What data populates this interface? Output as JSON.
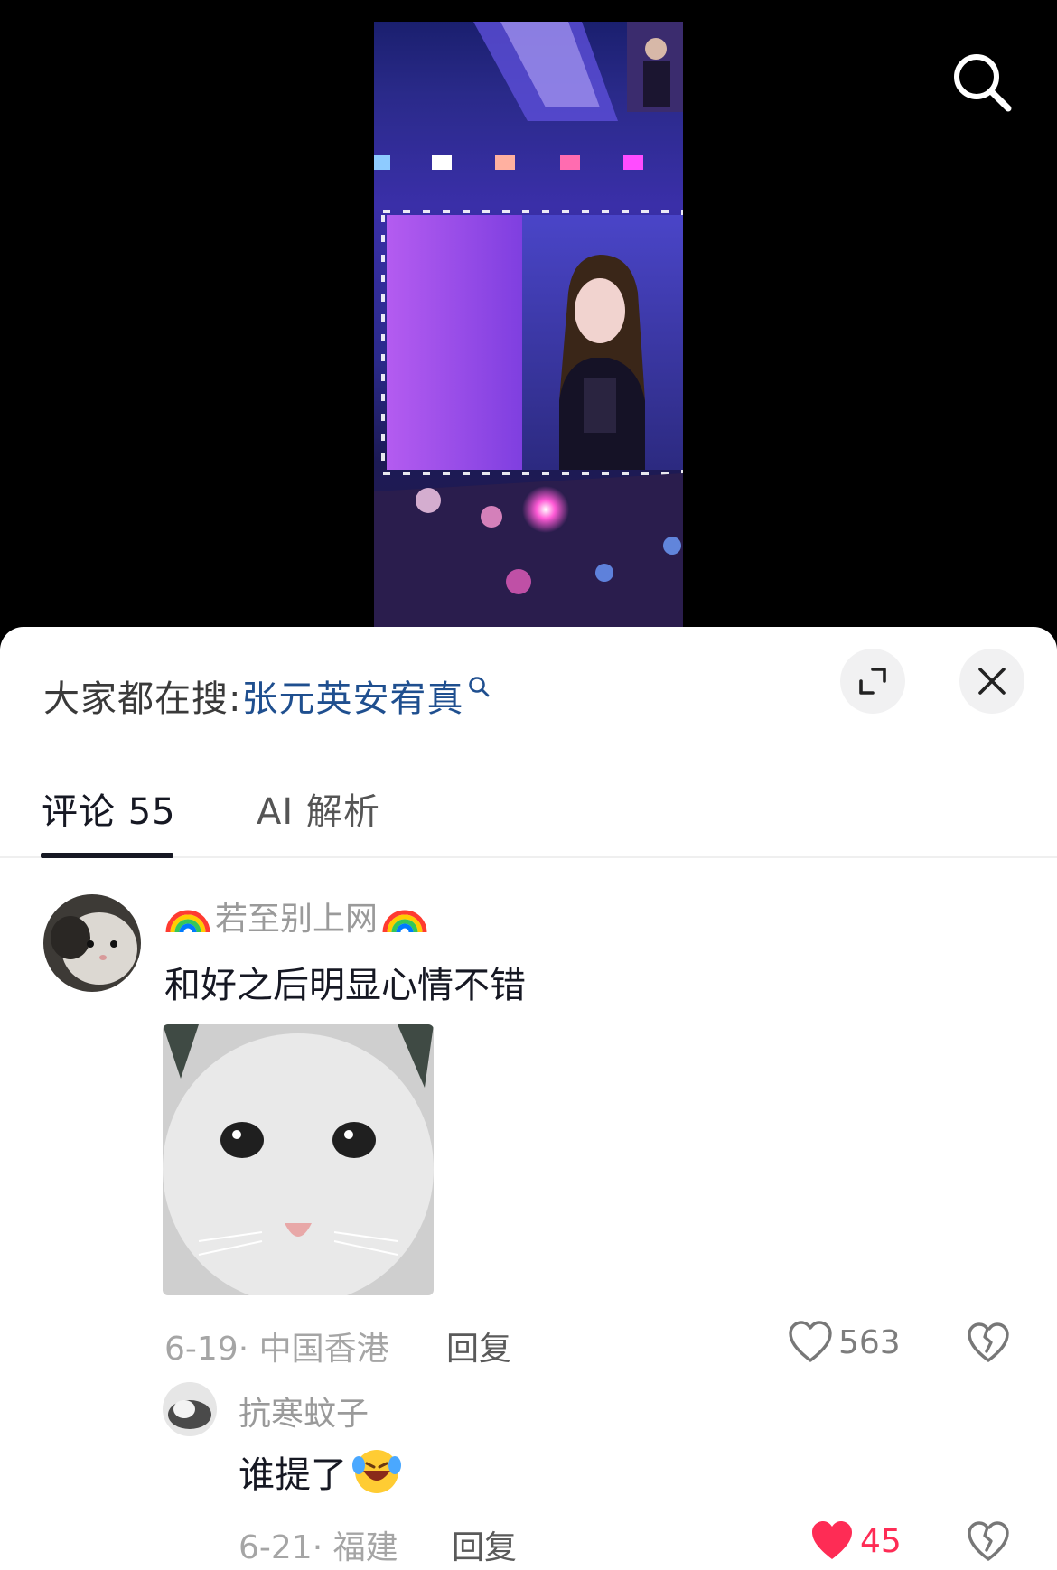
{
  "hot_search": {
    "label": "大家都在搜:",
    "term": "张元英安宥真"
  },
  "tabs": {
    "comments": "评论 55",
    "ai": "AI 解析"
  },
  "comment": {
    "author": "若至别上网",
    "author_badge": "rainbow-emoji",
    "text": "和好之后明显心情不错",
    "date": "6-19",
    "location": "中国香港",
    "reply_label": "回复",
    "likes": "563"
  },
  "reply": {
    "author": "抗寒蚊子",
    "text": "谁提了",
    "emoji": "laughing-crying-face-emoji",
    "date": "6-21",
    "location": "福建",
    "reply_label": "回复",
    "likes": "45",
    "liked": true
  },
  "colors": {
    "liked": "#fe2c55",
    "hot_term": "#1f4f8f",
    "sheet_bg": "#ffffff",
    "video_bg": "#000000"
  }
}
